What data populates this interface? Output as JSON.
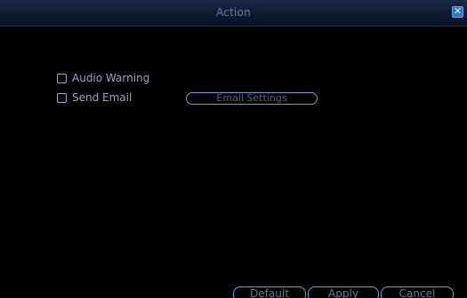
{
  "window": {
    "title": "Action",
    "close_glyph": "✕"
  },
  "options": {
    "audio_warning": {
      "label": "Audio Warning",
      "checked": false
    },
    "send_email": {
      "label": "Send Email",
      "checked": false
    }
  },
  "buttons": {
    "email_settings": "Email Settings",
    "default": "Default",
    "apply": "Apply",
    "cancel": "Cancel"
  },
  "colors": {
    "background": "#000000",
    "title_bar": "#14213b",
    "accent_border": "#6e9fd6",
    "close_button": "#2a79c8"
  }
}
